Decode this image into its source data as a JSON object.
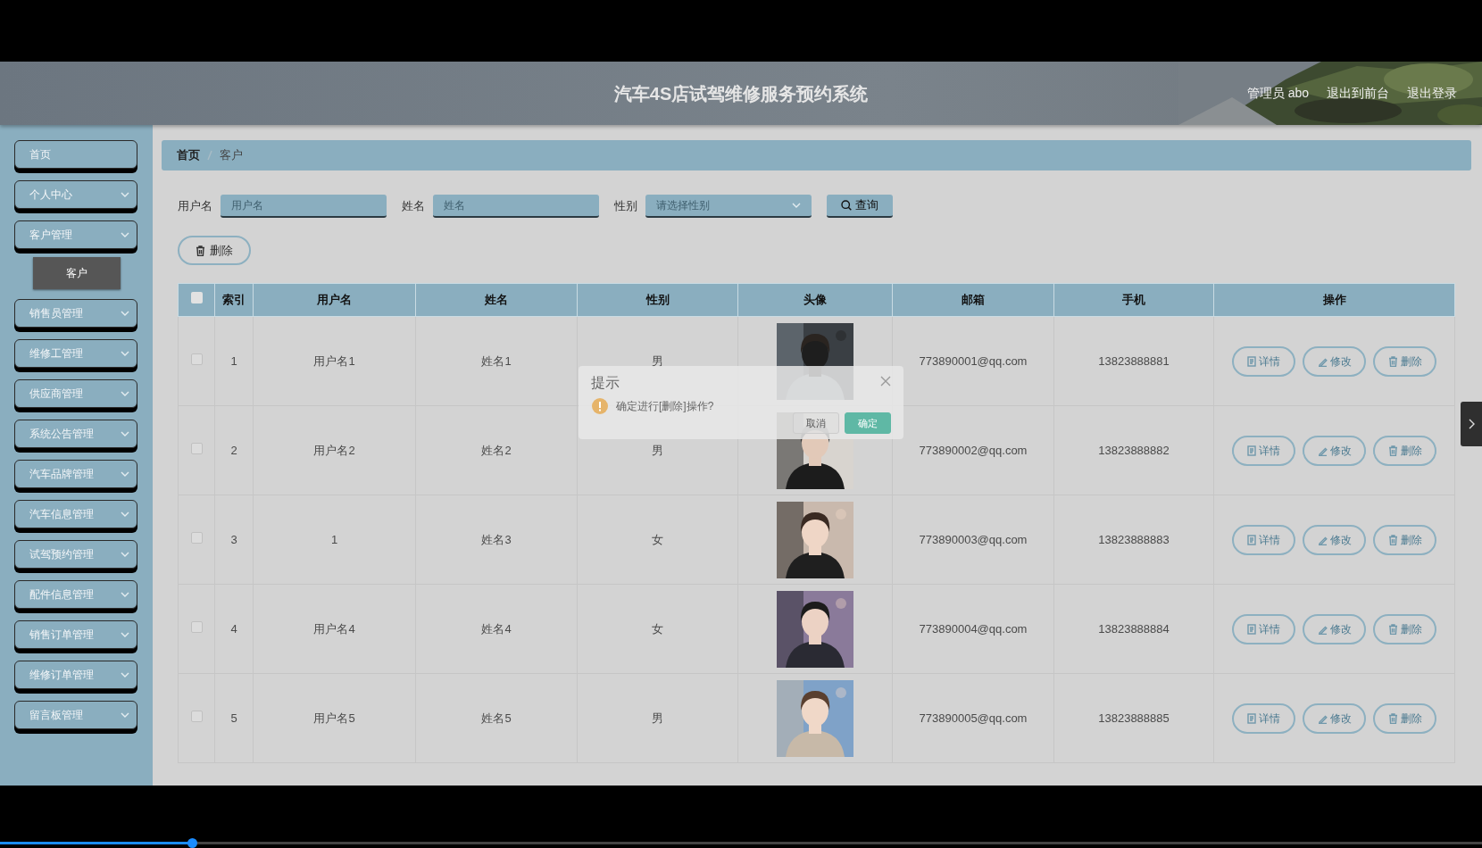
{
  "header": {
    "title": "汽车4S店试驾维修服务预约系统",
    "user": "管理员 abo",
    "links": [
      "退出到前台",
      "退出登录"
    ]
  },
  "sidebar": {
    "items": [
      {
        "label": "首页",
        "expandable": false
      },
      {
        "label": "个人中心",
        "expandable": true
      },
      {
        "label": "客户管理",
        "expandable": true,
        "children": [
          {
            "label": "客户",
            "selected": true
          }
        ]
      },
      {
        "label": "销售员管理",
        "expandable": true
      },
      {
        "label": "维修工管理",
        "expandable": true
      },
      {
        "label": "供应商管理",
        "expandable": true
      },
      {
        "label": "系统公告管理",
        "expandable": true
      },
      {
        "label": "汽车品牌管理",
        "expandable": true
      },
      {
        "label": "汽车信息管理",
        "expandable": true
      },
      {
        "label": "试驾预约管理",
        "expandable": true
      },
      {
        "label": "配件信息管理",
        "expandable": true
      },
      {
        "label": "销售订单管理",
        "expandable": true
      },
      {
        "label": "维修订单管理",
        "expandable": true
      },
      {
        "label": "留言板管理",
        "expandable": true
      }
    ]
  },
  "breadcrumb": [
    "首页",
    "客户"
  ],
  "search": {
    "fields": [
      {
        "label": "用户名",
        "placeholder": "用户名",
        "kind": "text"
      },
      {
        "label": "姓名",
        "placeholder": "姓名",
        "kind": "text"
      },
      {
        "label": "性别",
        "placeholder": "请选择性别",
        "kind": "select"
      }
    ],
    "button": "查询"
  },
  "delete_button": "删除",
  "table": {
    "select_all": {
      "checked": false
    },
    "columns": [
      "索引",
      "用户名",
      "姓名",
      "性别",
      "头像",
      "邮箱",
      "手机",
      "操作"
    ],
    "rows": [
      {
        "checked": false,
        "index": "1",
        "username": "用户名1",
        "name": "姓名1",
        "gender": "男",
        "email": "773890001@qq.com",
        "phone": "13823888881",
        "actions": [
          "详情",
          "修改",
          "删除"
        ]
      },
      {
        "checked": false,
        "index": "2",
        "username": "用户名2",
        "name": "姓名2",
        "gender": "男",
        "email": "773890002@qq.com",
        "phone": "13823888882",
        "actions": [
          "详情",
          "修改",
          "删除"
        ]
      },
      {
        "checked": false,
        "index": "3",
        "username": "1",
        "name": "姓名3",
        "gender": "女",
        "email": "773890003@qq.com",
        "phone": "13823888883",
        "actions": [
          "详情",
          "修改",
          "删除"
        ]
      },
      {
        "checked": false,
        "index": "4",
        "username": "用户名4",
        "name": "姓名4",
        "gender": "女",
        "email": "773890004@qq.com",
        "phone": "13823888884",
        "actions": [
          "详情",
          "修改",
          "删除"
        ]
      },
      {
        "checked": false,
        "index": "5",
        "username": "用户名5",
        "name": "姓名5",
        "gender": "男",
        "email": "773890005@qq.com",
        "phone": "13823888885",
        "actions": [
          "详情",
          "修改",
          "删除"
        ]
      }
    ]
  },
  "dialog": {
    "title": "提示",
    "message": "确定进行[删除]操作?",
    "buttons": [
      {
        "label": "取消",
        "kind": "secondary"
      },
      {
        "label": "确定",
        "kind": "primary"
      }
    ]
  },
  "player": {
    "level": 0.13
  }
}
